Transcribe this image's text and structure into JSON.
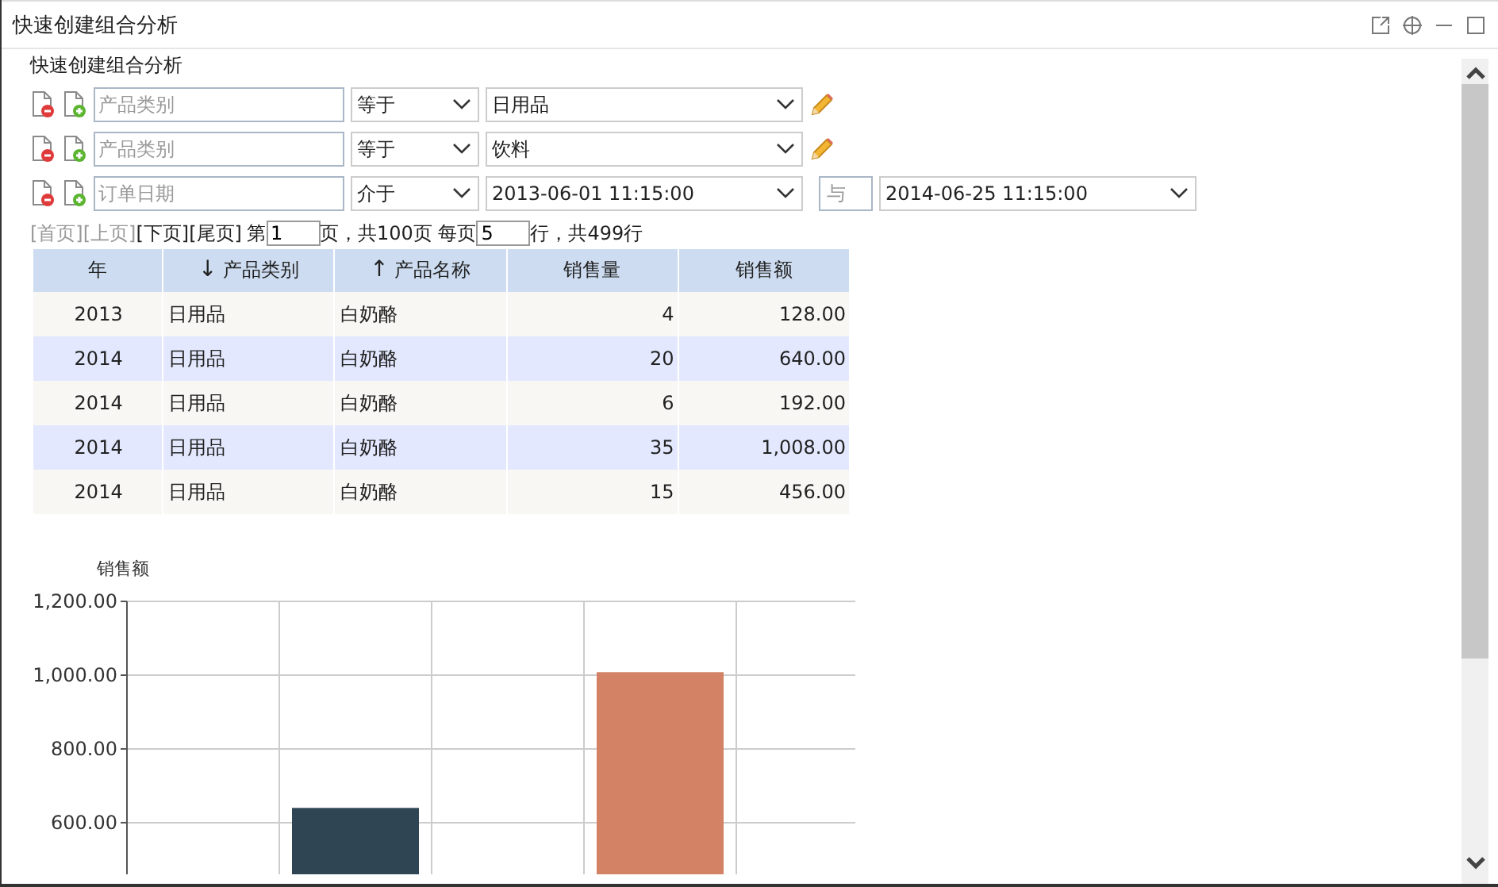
{
  "window": {
    "title": "快速创建组合分析"
  },
  "panel": {
    "title": "快速创建组合分析"
  },
  "filters": [
    {
      "kind": "single",
      "field_placeholder": "产品类别",
      "operator": "等于",
      "value": "日用品"
    },
    {
      "kind": "single",
      "field_placeholder": "产品类别",
      "operator": "等于",
      "value": "饮料"
    },
    {
      "kind": "range",
      "field_placeholder": "订单日期",
      "operator": "介于",
      "value": "2013-06-01 11:15:00",
      "joiner_placeholder": "与",
      "value_2": "2014-06-25 11:15:00"
    }
  ],
  "pager": {
    "links": [
      {
        "label": "[首页]",
        "disabled": true
      },
      {
        "label": "[上页]",
        "disabled": true
      },
      {
        "label": "[下页]",
        "disabled": false
      },
      {
        "label": "[尾页]",
        "disabled": false
      }
    ],
    "page_prefix": "第",
    "page": "1",
    "page_suffix": "页，共100页 每页",
    "per_page": "5",
    "total": "行，共499行"
  },
  "table": {
    "columns": [
      {
        "label": "年"
      },
      {
        "label": "产品类别",
        "sort": "↓"
      },
      {
        "label": "产品名称",
        "sort": "↑"
      },
      {
        "label": "销售量"
      },
      {
        "label": "销售额"
      }
    ],
    "rows": [
      [
        "2013",
        "日用品",
        "白奶酪",
        "4",
        "128.00"
      ],
      [
        "2014",
        "日用品",
        "白奶酪",
        "20",
        "640.00"
      ],
      [
        "2014",
        "日用品",
        "白奶酪",
        "6",
        "192.00"
      ],
      [
        "2014",
        "日用品",
        "白奶酪",
        "35",
        "1,008.00"
      ],
      [
        "2014",
        "日用品",
        "白奶酪",
        "15",
        "456.00"
      ]
    ]
  },
  "chart_data": {
    "type": "bar",
    "ylabel": "销售额",
    "values": [
      null,
      640,
      null,
      1008,
      null
    ],
    "colors": [
      null,
      "#2f4554",
      null,
      "#d48265",
      null
    ],
    "grid": true,
    "ylim": [
      460,
      1200
    ],
    "yticks": [
      {
        "value": 600,
        "label": "600.00"
      },
      {
        "value": 800,
        "label": "800.00"
      },
      {
        "value": 1000,
        "label": "1,000.00"
      },
      {
        "value": 1200,
        "label": "1,200.00"
      }
    ]
  }
}
